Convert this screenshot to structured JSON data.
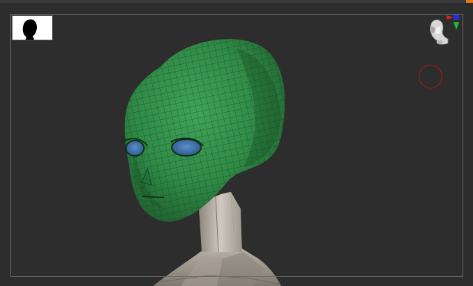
{
  "app": {
    "view": "3d-viewport"
  },
  "scene": {
    "object": "alien-head-mesh",
    "head_color": "#2f8a45",
    "eye_color": "#3b6ea8",
    "neck_color": "#c9c3ba",
    "background_color": "#2d2d2d"
  },
  "ui": {
    "accent_color": "#e07a1a",
    "frame_color": "#6b6b6b",
    "gizmo_ring_color": "#b01818",
    "axis_colors": {
      "x": "#e0201e",
      "y": "#1ec21e",
      "z": "#1e2ee0"
    }
  },
  "icons": {
    "thumbnail": "silhouette-icon",
    "nav": "head-navigator-icon",
    "axis": "axis-gizmo-icon",
    "ring": "rotation-ring-icon"
  }
}
